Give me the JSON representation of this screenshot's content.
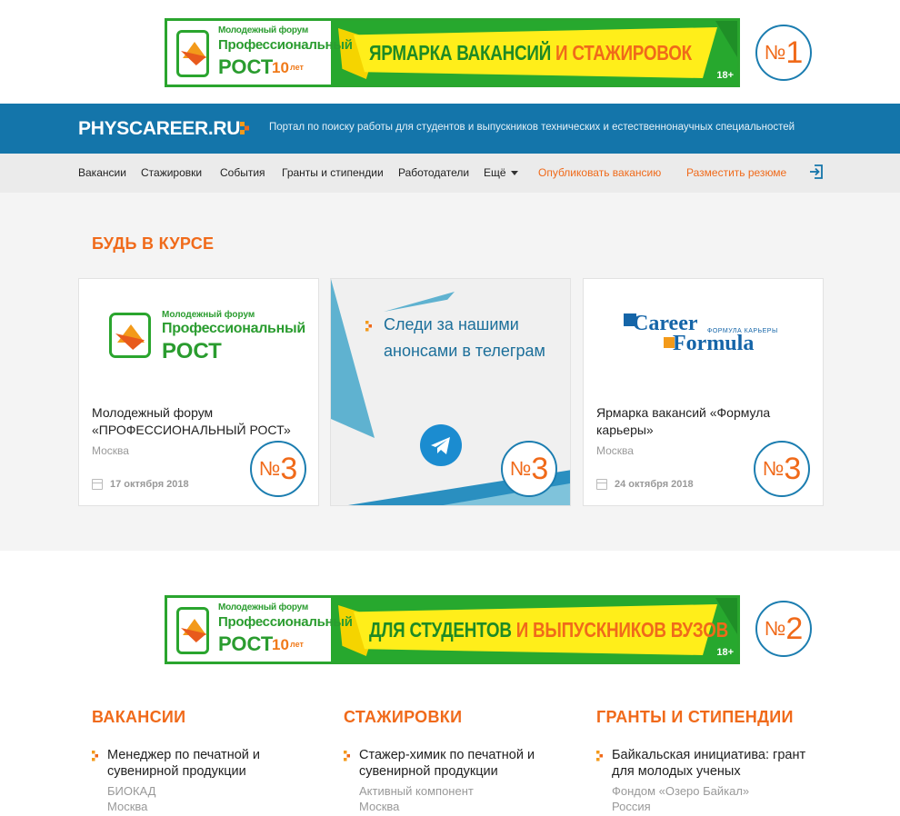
{
  "banner_top": {
    "forum_small": "Молодежный форум",
    "forum_mid": "Профессиональный",
    "forum_big": "РОСТ",
    "years_num": "10",
    "years_word": "лет",
    "headline_green": "ЯРМАРКА ВАКАНСИЙ",
    "headline_orange": "И СТАЖИРОВОК",
    "age": "18+",
    "badge_prefix": "№",
    "badge_digit": "1"
  },
  "header": {
    "logo": "PHYSCAREER.RU",
    "tagline": "Портал по поиску работы для студентов и выпускников технических и естественнонаучных специальностей"
  },
  "nav": {
    "items": [
      "Вакансии",
      "Стажировки",
      "События",
      "Гранты и стипендии",
      "Работодатели",
      "Ещё"
    ],
    "publish_vacancy": "Опубликовать вакансию",
    "post_resume": "Разместить резюме"
  },
  "stay_tuned": {
    "title": "БУДЬ В КУРСЕ",
    "cards": [
      {
        "logo_small": "Молодежный форум",
        "logo_mid": "Профессиональный",
        "logo_big": "РОСТ",
        "title": "Молодежный форум «ПРОФЕССИОНАЛЬНЫЙ РОСТ»",
        "city": "Москва",
        "date": "17 октября 2018",
        "badge_prefix": "№",
        "badge_digit": "3"
      },
      {
        "text": "Следи за нашими анонсами в телеграм",
        "badge_prefix": "№",
        "badge_digit": "3"
      },
      {
        "logo_w1": "Career",
        "logo_w2": "Formula",
        "logo_small": "ФОРМУЛА КАРЬЕРЫ",
        "title": "Ярмарка вакансий «Формула карьеры»",
        "city": "Москва",
        "date": "24 октября 2018",
        "badge_prefix": "№",
        "badge_digit": "3"
      }
    ]
  },
  "banner_mid": {
    "forum_small": "Молодежный форум",
    "forum_mid": "Профессиональный",
    "forum_big": "РОСТ",
    "years_num": "10",
    "years_word": "лет",
    "headline_green": "ДЛЯ СТУДЕНТОВ",
    "headline_orange": "И ВЫПУСКНИКОВ ВУЗОВ",
    "age": "18+",
    "badge_prefix": "№",
    "badge_digit": "2"
  },
  "lists": [
    {
      "title": "ВАКАНСИИ",
      "item_title": "Менеджер по печатной и сувенирной продукции",
      "company": "БИОКАД",
      "city": "Москва"
    },
    {
      "title": "СТАЖИРОВКИ",
      "item_title": "Стажер-химик по печатной и сувенирной продукции",
      "company": "Активный компонент",
      "city": "Москва"
    },
    {
      "title": "ГРАНТЫ И СТИПЕНДИИ",
      "item_title": "Байкальская инициатива: грант для молодых ученых",
      "company": "Фондом «Озеро Байкал»",
      "city": "Россия"
    }
  ],
  "colors": {
    "header_blue": "#1475aa",
    "accent_orange": "#f06a1a",
    "banner_green": "#27a82e",
    "banner_yellow": "#ffee1a"
  },
  "icons": [
    "login-icon",
    "calendar-icon",
    "telegram-icon",
    "arrow-bullet-icon",
    "caret-down-icon"
  ]
}
